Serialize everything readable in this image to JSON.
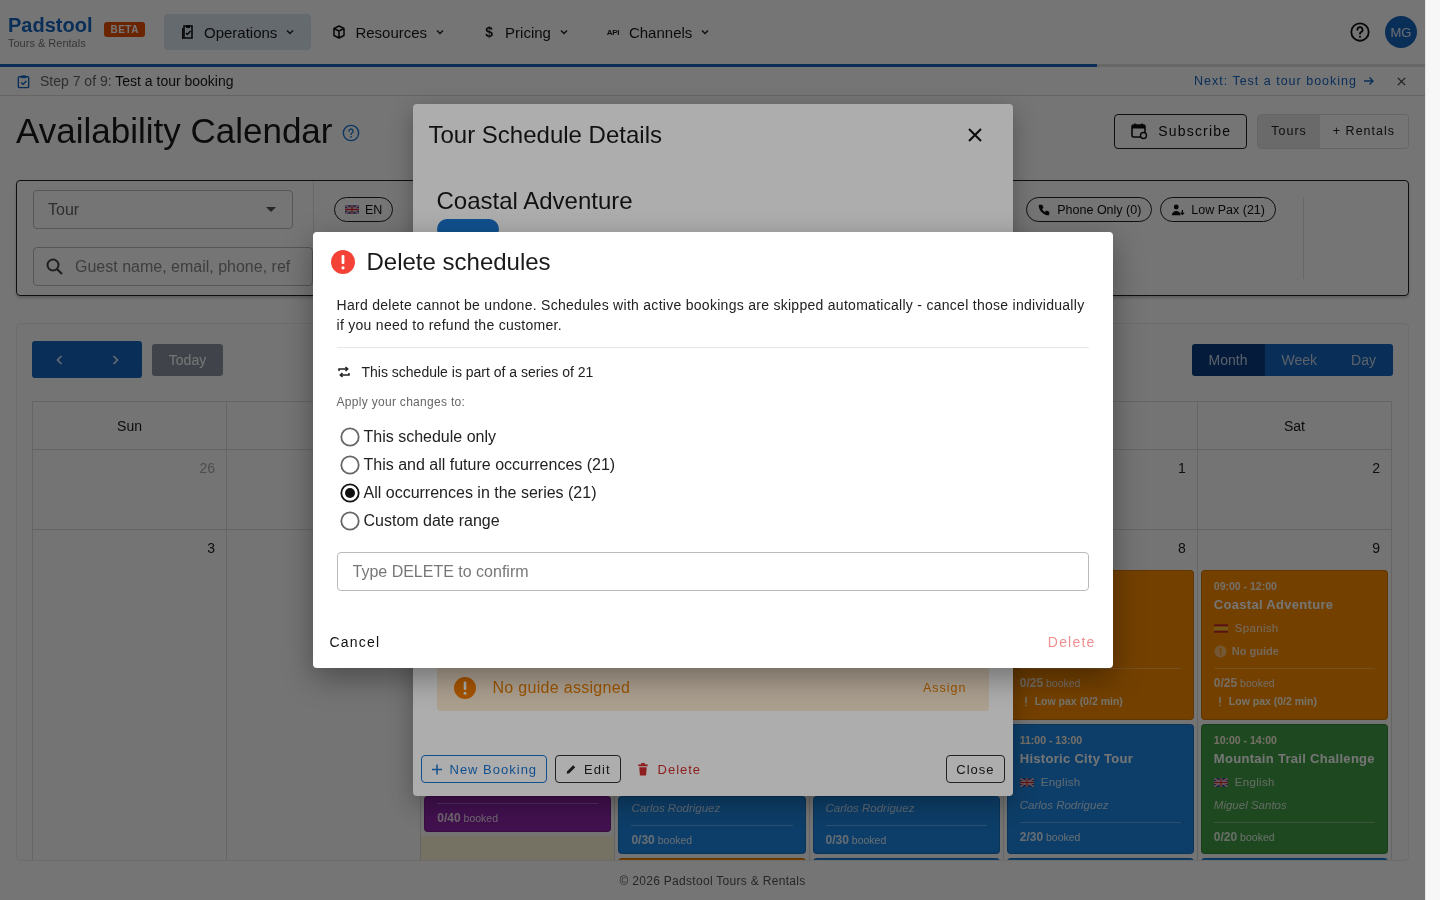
{
  "header": {
    "logo": "Padstool",
    "tagline": "Tours & Rentals",
    "badge": "BETA",
    "nav": [
      {
        "label": "Operations",
        "selected": true
      },
      {
        "label": "Resources",
        "selected": false
      },
      {
        "label": "Pricing",
        "glyph": "$",
        "selected": false
      },
      {
        "label": "Channels",
        "glyph": "API",
        "selected": false
      }
    ],
    "avatar": "MG"
  },
  "onboarding": {
    "level": 0.77,
    "step": "Step 7 of 9:",
    "task": "Test a tour booking",
    "next": "Next: Test a tour booking"
  },
  "page": {
    "title": "Availability Calendar",
    "subscribe": "Subscribe",
    "modes": [
      {
        "label": "Tours",
        "selected": true
      },
      {
        "label": "+ Rentals",
        "selected": false
      }
    ]
  },
  "filters": {
    "tour_select": "Tour",
    "search_placeholder": "Guest name, email, phone, ref",
    "chips_left": [
      {
        "label": "EN"
      }
    ],
    "chips_right": [
      {
        "label": "Phone Only (0)"
      },
      {
        "label": "Low Pax (21)"
      }
    ]
  },
  "calendar": {
    "today": "Today",
    "views": [
      {
        "label": "Month",
        "selected": true
      },
      {
        "label": "Week",
        "selected": false
      },
      {
        "label": "Day",
        "selected": false
      }
    ],
    "weekday_first": "Sun",
    "weekday_last": "Sat",
    "weeks": [
      {
        "cells": [
          {
            "date": "26",
            "muted": true
          },
          {},
          {},
          {},
          {},
          {
            "date": "1",
            "muted": false
          },
          {
            "date": "2",
            "muted": false
          }
        ]
      },
      {
        "cells": [
          {
            "date": "3",
            "muted": false
          },
          {},
          {
            "today": true,
            "covered_top": true,
            "events": [
              {
                "color": "#42114f",
                "booked": "**0/40** booked"
              }
            ]
          },
          {
            "covered_top": true,
            "events": [
              {
                "color": "#0e3f6a",
                "guide": {
                  "name": "Carlos Rodriguez",
                  "assigned": true
                },
                "booked": "**0/30** booked"
              },
              {
                "color": "#744100"
              }
            ]
          },
          {
            "covered_top": true,
            "events": [
              {
                "color": "#0e3f6a",
                "guide": {
                  "name": "Carlos Rodriguez",
                  "assigned": true
                },
                "booked": "**0/30** booked"
              },
              {
                "color": "#0e3f6a"
              }
            ]
          },
          {
            "date": "8",
            "muted": false,
            "events": [
              {
                "color": "#744100",
                "booked": "**0/25** booked",
                "warning": "Low pax (0/2 min)"
              },
              {
                "color": "#0e3f6a",
                "time": "11:00 - 13:00",
                "title": "Historic City Tour",
                "language": {
                  "name": "English",
                  "kind": "uk"
                },
                "guide": {
                  "name": "Carlos Rodriguez",
                  "assigned": true
                },
                "booked": "**2/30** booked"
              },
              {
                "color": "#0e3f6a"
              }
            ]
          },
          {
            "date": "9",
            "muted": false,
            "events": [
              {
                "color": "#744100",
                "time": "09:00 - 12:00",
                "title": "Coastal Adventure",
                "language": {
                  "name": "Spanish",
                  "kind": "es"
                },
                "guide": {
                  "name": "No guide",
                  "assigned": false
                },
                "booked": "**0/25** booked",
                "warning": "Low pax (0/2 min)"
              },
              {
                "color": "#1f4a21",
                "time": "10:00 - 14:00",
                "title": "Mountain Trail Challenge",
                "language": {
                  "name": "English",
                  "kind": "uk"
                },
                "guide": {
                  "name": "Miguel Santos",
                  "assigned": true
                },
                "booked": "**0/20** booked"
              },
              {
                "color": "#0e3f6a"
              }
            ]
          }
        ]
      }
    ]
  },
  "footer": "© 2026 Padstool Tours & Rentals",
  "schedule_dialog": {
    "title": "Tour Schedule Details",
    "tour": "Coastal Adventure",
    "alert": "No guide assigned",
    "alert_action": "Assign",
    "new_booking": "New Booking",
    "edit": "Edit",
    "delete": "Delete",
    "close": "Close"
  },
  "delete_dialog": {
    "title": "Delete schedules",
    "message": "Hard delete cannot be undone. Schedules with active bookings are skipped automatically - cancel those individually if you need to refund the customer.",
    "series_note": "This schedule is part of a series of 21",
    "apply_label": "Apply your changes to:",
    "options": [
      {
        "label": "This schedule only",
        "selected": false
      },
      {
        "label": "This and all future occurrences (21)",
        "selected": false
      },
      {
        "label": "All occurrences in the series (21)",
        "selected": true
      },
      {
        "label": "Custom date range",
        "selected": false
      }
    ],
    "confirm_placeholder": "Type DELETE to confirm",
    "cancel": "Cancel",
    "confirm": "Delete",
    "confirm_disabled": true
  }
}
